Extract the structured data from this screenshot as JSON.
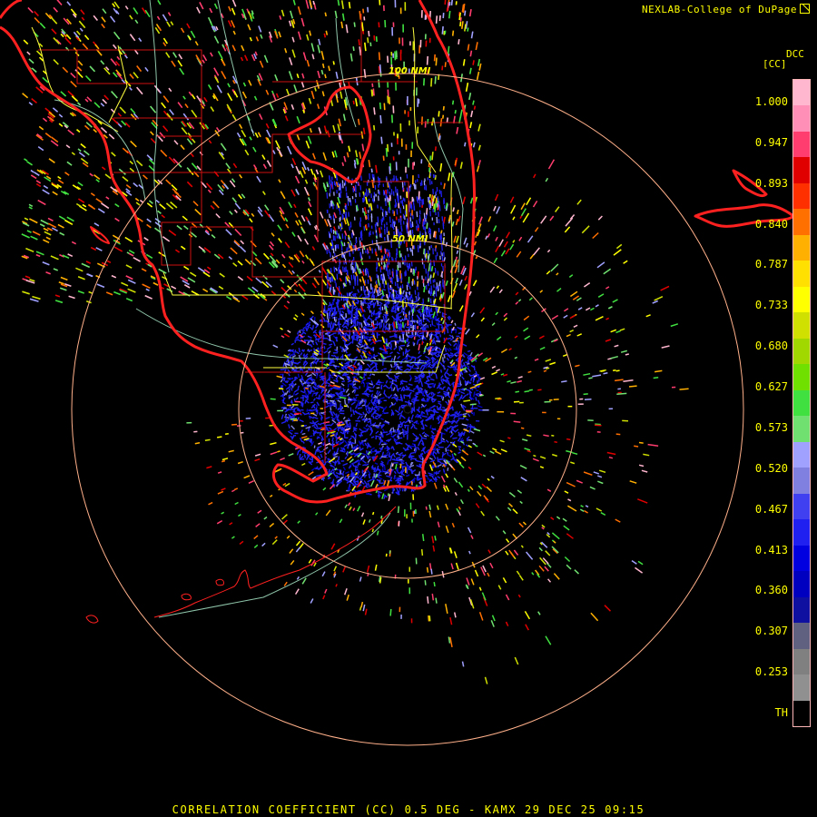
{
  "header": {
    "credit": "NEXLAB-College of DuPage",
    "logo_icon": "nexlab-logo-icon"
  },
  "map": {
    "station": "KAMX",
    "region": "South Florida",
    "rings": [
      {
        "label": "50 NMI"
      },
      {
        "label": "100 NMI"
      }
    ],
    "colors": {
      "background": "#000000",
      "coastline": "#ff2020",
      "county_lines": "#cc1111",
      "highways": "#ffff40",
      "minor_roads": "#a8e8c8",
      "range_rings": "#ffb08a",
      "station_marker": "#000000"
    }
  },
  "legend": {
    "product_code": "DCC",
    "unit": "[CC]",
    "labels": [
      "1.000",
      "0.947",
      "0.893",
      "0.840",
      "0.787",
      "0.733",
      "0.680",
      "0.627",
      "0.573",
      "0.520",
      "0.467",
      "0.413",
      "0.360",
      "0.307",
      "0.253",
      "TH"
    ],
    "color_stops": [
      "#ffb6cf",
      "#ff8fb6",
      "#ff3d6e",
      "#e00000",
      "#ff3000",
      "#ff7000",
      "#ffb000",
      "#ffe000",
      "#ffff00",
      "#d0e000",
      "#a0d800",
      "#70e000",
      "#40e040",
      "#70e070",
      "#a0a0ff",
      "#8080e0",
      "#4040f0",
      "#2020f0",
      "#0000e0",
      "#0000c0",
      "#1010a0",
      "#606080",
      "#808080",
      "#909090",
      "#000000"
    ]
  },
  "footer": {
    "caption": "CORRELATION COEFFICIENT (CC) 0.5 DEG - KAMX 29 DEC 25 09:15"
  }
}
